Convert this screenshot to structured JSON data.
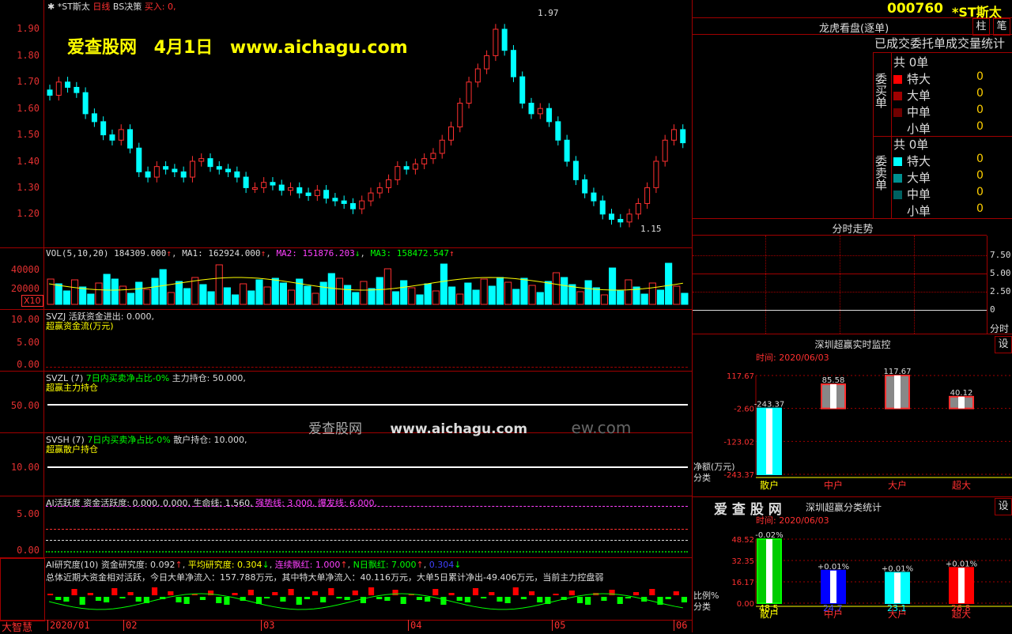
{
  "header": {
    "stock_name": "*ST斯太",
    "period": "日线",
    "strategy": "BS决策",
    "buy_label": "买入: 0,",
    "watermark": "爱查股网 4月1日 www.aichagu.com",
    "mid_watermark1": "爱查股网",
    "mid_watermark2": "www.aichagu.com",
    "mid_watermark3": "ew.com"
  },
  "price_axis": [
    "1.90",
    "1.80",
    "1.70",
    "1.60",
    "1.50",
    "1.40",
    "1.30",
    "1.20"
  ],
  "annotations": {
    "high": "1.97",
    "low": "1.15"
  },
  "vol": {
    "header": "VOL(5,10,20)",
    "val": "184309.000",
    "ma1": "MA1: 162924.000",
    "ma2": "MA2: 151876.203",
    "ma3": "MA3: 158472.547",
    "axis": [
      "40000",
      "20000"
    ],
    "unit": "X10"
  },
  "svzj": {
    "title": "SVZJ  活跃资金进出: 0.000,",
    "sub": "超赢资金流(万元)",
    "axis": [
      "10.00",
      "5.00",
      "0.00"
    ]
  },
  "svzl": {
    "title": "SVZL (7)",
    "pct": "7日内买卖净占比-0%",
    "holding": "主力持仓: 50.000,",
    "sub": "超赢主力持仓",
    "axis": [
      "50.00"
    ]
  },
  "svsh": {
    "title": "SVSH (7)",
    "pct": "7日内买卖净占比-0%",
    "holding": "散户持仓: 10.000,",
    "sub": "超赢散户持仓",
    "axis": [
      "10.00"
    ]
  },
  "ai_active": {
    "title": "AI活跃度 资金活跃度: 0.000, 0.000, 生命线: 1.560,",
    "strong": "强势线: 3.000,",
    "burst": "爆发线: 6.000,",
    "axis": [
      "5.00",
      "0.00"
    ]
  },
  "ai_research": {
    "p1": "AI研究度(10) 资金研究度: 0.092",
    "p2": "平均研究度: 0.304",
    "p3": "连续飘红: 1.000",
    "p4": "N日飘红: 7.000",
    "p5": "0.304",
    "summary": "总体近期大资金相对活跃，今日大单净流入：157.788万元，其中特大单净流入：40.116万元，大单5日累计净出-49.406万元，当前主力控盘弱"
  },
  "date_axis": [
    "2020/01",
    "02",
    "03",
    "04",
    "05",
    "06"
  ],
  "brand": "大智慧",
  "right": {
    "code": "000760",
    "name": "*ST斯太",
    "btn1": "柱",
    "btn2": "笔",
    "dragon_title": "龙虎看盘(逐单)",
    "stats_title": "已成交委托单成交量统计",
    "buy_label": "委买单",
    "sell_label": "委卖单",
    "buy_total": "共 0单",
    "sell_total": "共 0单",
    "rows": [
      "特大",
      "大单",
      "中单",
      "小单"
    ],
    "buy_vals": [
      "0",
      "0",
      "0",
      "0"
    ],
    "sell_vals": [
      "0",
      "0",
      "0",
      "0"
    ],
    "buy_colors": [
      "#ff0000",
      "#a00000",
      "#700000",
      "#000000"
    ],
    "sell_colors": [
      "#00ffff",
      "#009090",
      "#006060",
      "#000000"
    ],
    "intraday_title": "分时走势",
    "intraday_axis": [
      "7.50",
      "5.00",
      "2.50",
      "0"
    ],
    "intraday_unit": "分时",
    "monitor_title": "深圳超赢实时监控",
    "monitor_btn": "设",
    "monitor_time": "时间: 2020/06/03",
    "monitor_axis": [
      "117.67",
      "-2.60",
      "-123.02",
      "-243.37"
    ],
    "monitor_ylabel": "净额(万元)",
    "monitor_xlabel": "分类",
    "class_title": "深圳超赢分类统计",
    "class_brand": "爱 查 股 网",
    "class_btn": "设",
    "class_time": "时间: 2020/06/03",
    "class_axis": [
      "48.52",
      "32.35",
      "16.17",
      "0.00"
    ],
    "class_ylabel": "比例%",
    "class_xlabel": "分类",
    "categories": [
      "散户",
      "中户",
      "大户",
      "超大"
    ]
  },
  "chart_data": [
    {
      "type": "bar",
      "title": "深圳超赢实时监控",
      "categories": [
        "散户",
        "中户",
        "大户",
        "超大"
      ],
      "values": [
        -243.37,
        85.58,
        117.67,
        40.12
      ],
      "ylim": [
        -243.37,
        117.67
      ]
    },
    {
      "type": "bar",
      "title": "深圳超赢分类统计",
      "categories": [
        "散户",
        "中户",
        "大户",
        "超大"
      ],
      "values": [
        48.5,
        24.7,
        23.1,
        26.8
      ],
      "change_labels": [
        "-0.02%",
        "+0.01%",
        "+0.01%",
        "+0.01%"
      ],
      "ylim": [
        0,
        48.52
      ]
    }
  ]
}
